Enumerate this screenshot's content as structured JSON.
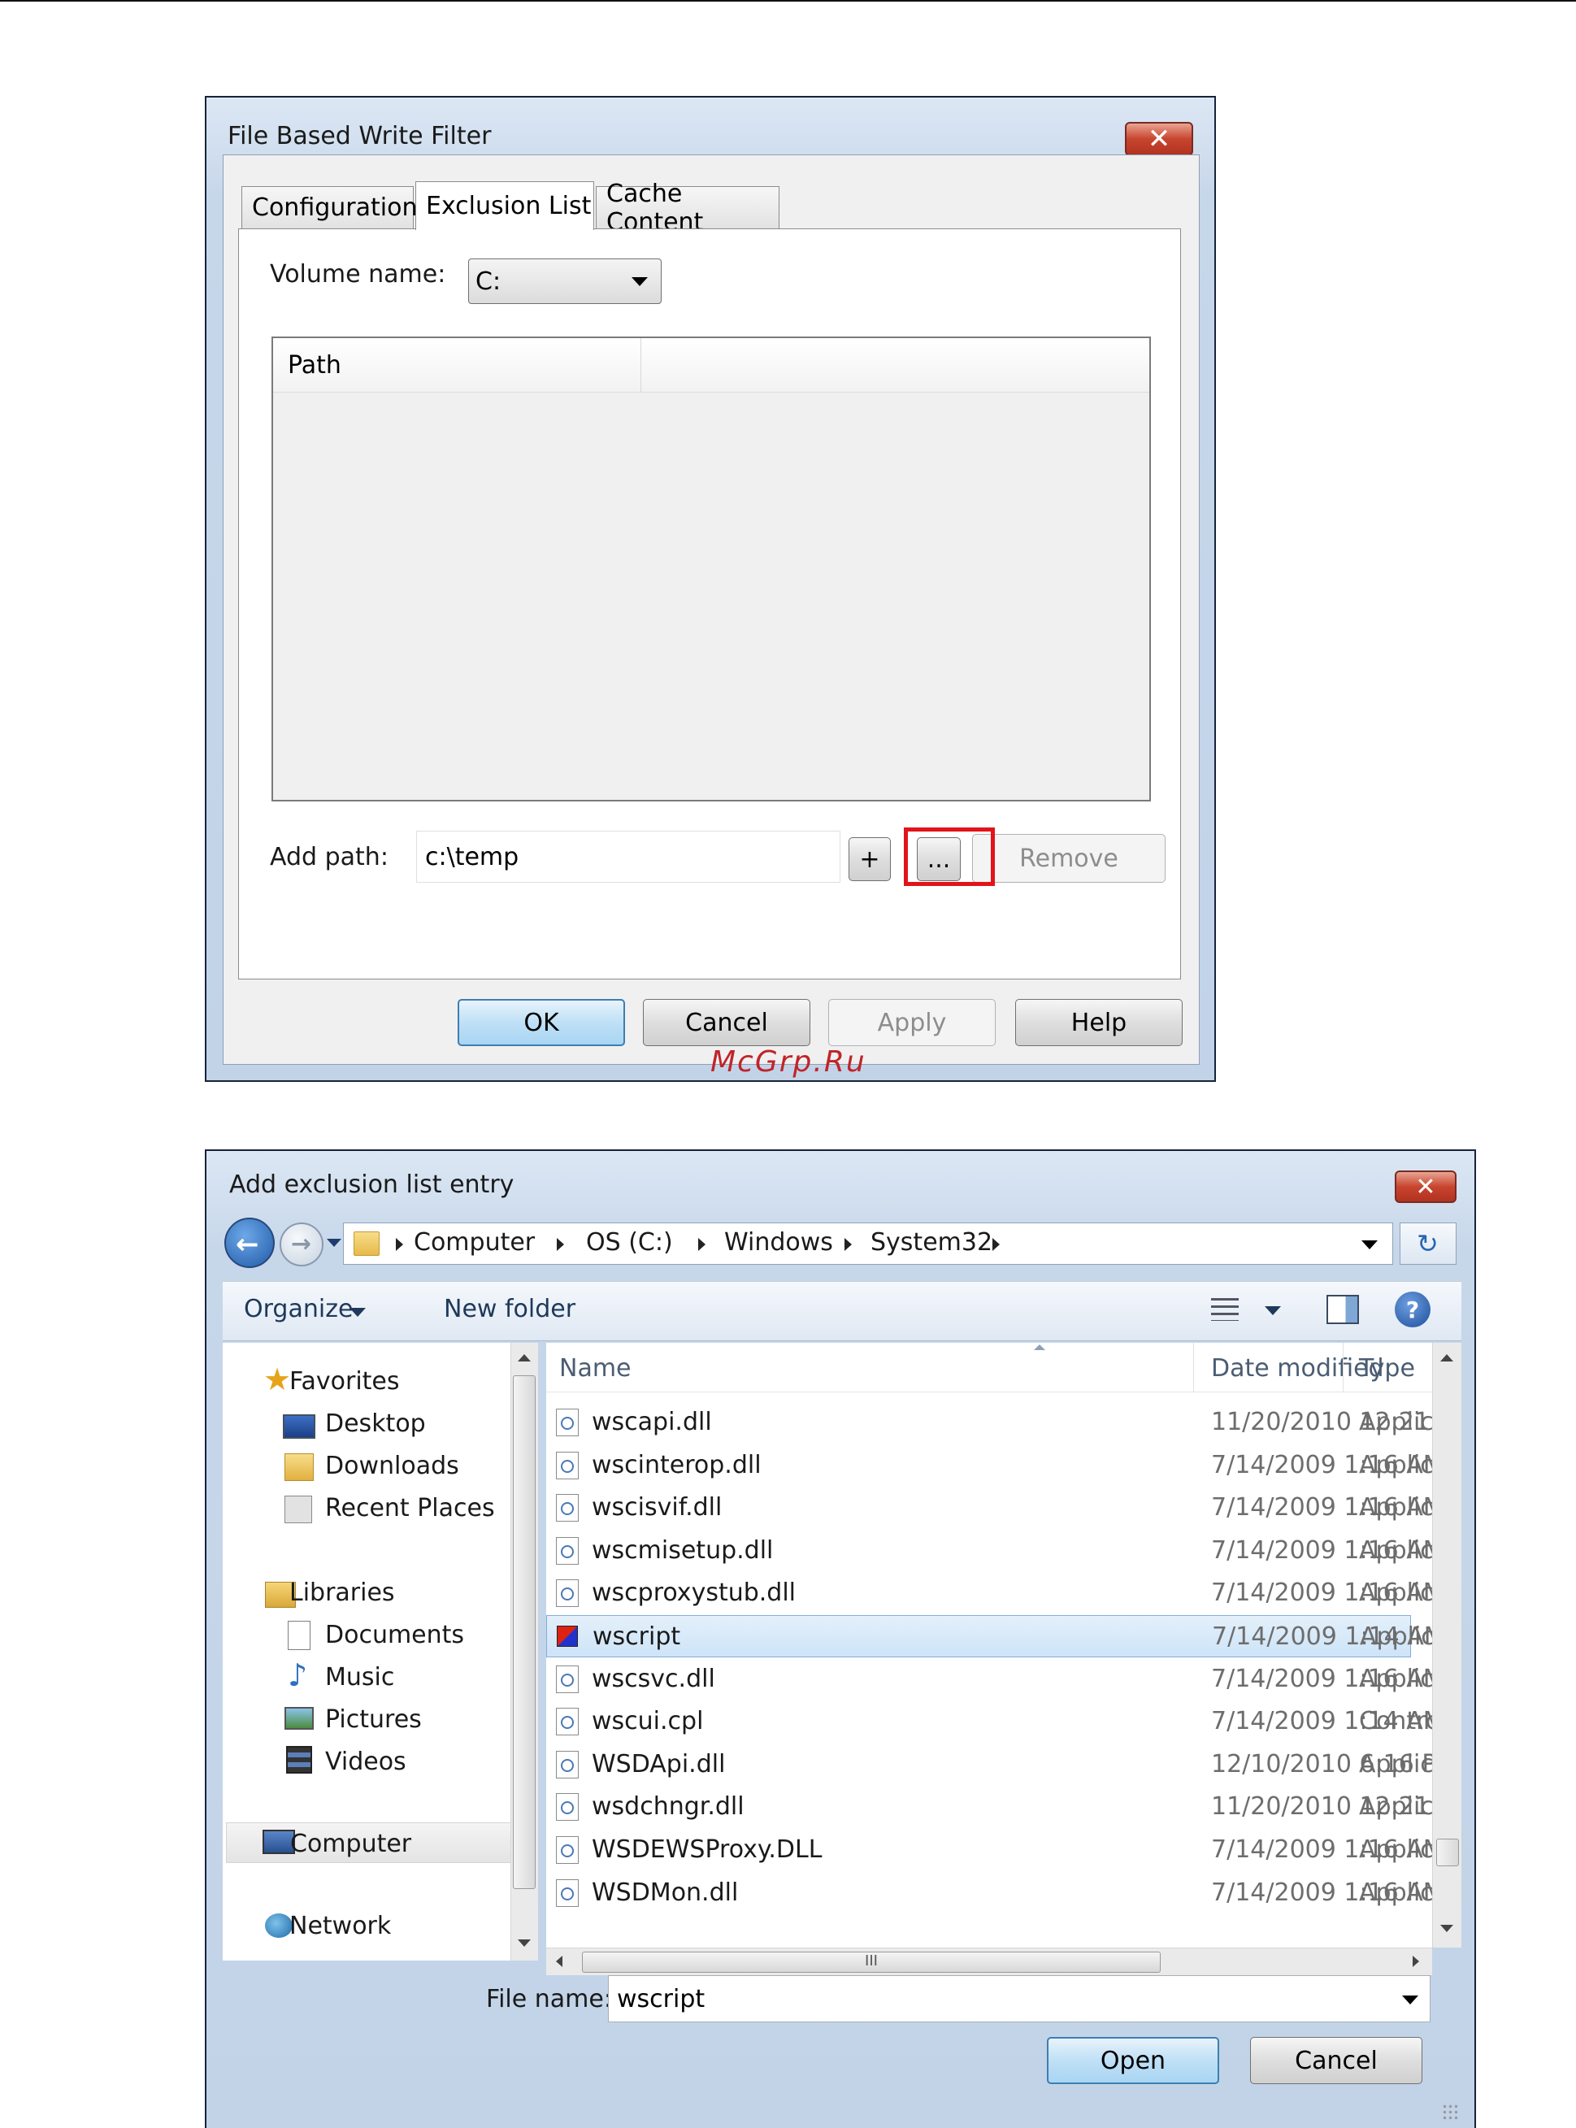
{
  "watermark": "McGrp.Ru",
  "dialog1": {
    "title": "File Based Write Filter",
    "close": "✕",
    "tabs": [
      "Configuration",
      "Exclusion List",
      "Cache Content"
    ],
    "volume_label": "Volume name:",
    "volume_value": "C:",
    "list_header": "Path",
    "add_path_label": "Add path:",
    "add_path_value": "c:\\temp",
    "plus": "+",
    "browse": "...",
    "remove": "Remove",
    "ok": "OK",
    "cancel": "Cancel",
    "apply": "Apply",
    "help": "Help"
  },
  "dialog2": {
    "title": "Add exclusion list entry",
    "close": "✕",
    "breadcrumb": [
      "Computer",
      "OS (C:)",
      "Windows",
      "System32"
    ],
    "refresh": "↻",
    "organize": "Organize",
    "new_folder": "New folder",
    "help_icon": "?",
    "nav": {
      "favorites": "Favorites",
      "desktop": "Desktop",
      "downloads": "Downloads",
      "recent": "Recent Places",
      "libraries": "Libraries",
      "documents": "Documents",
      "music": "Music",
      "pictures": "Pictures",
      "videos": "Videos",
      "computer": "Computer",
      "network": "Network"
    },
    "columns": {
      "name": "Name",
      "date": "Date modified",
      "type": "Type"
    },
    "files": [
      {
        "name": "wscapi.dll",
        "date": "11/20/2010 12:21 ...",
        "type": "Applic"
      },
      {
        "name": "wscinterop.dll",
        "date": "7/14/2009 1:16 AM",
        "type": "Applic"
      },
      {
        "name": "wscisvif.dll",
        "date": "7/14/2009 1:16 AM",
        "type": "Applic"
      },
      {
        "name": "wscmisetup.dll",
        "date": "7/14/2009 1:16 AM",
        "type": "Applic"
      },
      {
        "name": "wscproxystub.dll",
        "date": "7/14/2009 1:16 AM",
        "type": "Applic"
      },
      {
        "name": "wscript",
        "date": "7/14/2009 1:14 AM",
        "type": "Applic",
        "selected": true
      },
      {
        "name": "wscsvc.dll",
        "date": "7/14/2009 1:16 AM",
        "type": "Applic"
      },
      {
        "name": "wscui.cpl",
        "date": "7/14/2009 1:14 AM",
        "type": "Contrc"
      },
      {
        "name": "WSDApi.dll",
        "date": "12/10/2010 6:16 PM",
        "type": "Applic"
      },
      {
        "name": "wsdchngr.dll",
        "date": "11/20/2010 12:21 ...",
        "type": "Applic"
      },
      {
        "name": "WSDEWSProxy.DLL",
        "date": "7/14/2009 1:16 AM",
        "type": "Applic"
      },
      {
        "name": "WSDMon.dll",
        "date": "7/14/2009 1:16 AM",
        "type": "Applic"
      }
    ],
    "hscroll_grip": "III",
    "filename_label": "File name:",
    "filename_value": "wscript",
    "open": "Open",
    "cancel": "Cancel"
  }
}
